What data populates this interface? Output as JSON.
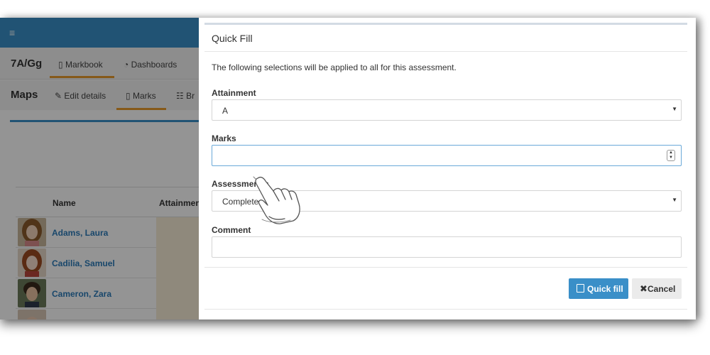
{
  "header": {
    "menu_icon": "≡"
  },
  "subnav": {
    "class_name": "7A/Gg",
    "tabs": [
      {
        "label": "Markbook",
        "icon": "book-icon"
      },
      {
        "label": "Dashboards",
        "icon": "dashboard-icon"
      }
    ]
  },
  "secnav": {
    "title": "Maps",
    "tabs": [
      {
        "label": "Edit details",
        "icon": "edit-icon"
      },
      {
        "label": "Marks",
        "icon": "book-icon"
      },
      {
        "label": "Br",
        "icon": "sitemap-icon"
      }
    ]
  },
  "table": {
    "headers": [
      "Name",
      "Attainmen"
    ],
    "rows": [
      {
        "name": "Adams, Laura"
      },
      {
        "name": "Cadilia, Samuel"
      },
      {
        "name": "Cameron, Zara"
      }
    ]
  },
  "modal": {
    "title": "Quick Fill",
    "description": "The following selections will be applied to all for this assessment.",
    "fields": {
      "attainment": {
        "label": "Attainment",
        "value": "A"
      },
      "marks": {
        "label": "Marks",
        "value": ""
      },
      "assessment_status": {
        "label": "Assessment s",
        "value": "Complete"
      },
      "comment": {
        "label": "Comment",
        "value": ""
      }
    },
    "buttons": {
      "primary": "Quick fill",
      "cancel": "Cancel"
    }
  },
  "colors": {
    "brand_blue": "#3a8fc8",
    "accent_orange": "#e79a2b",
    "link_blue": "#2b7bb9"
  }
}
